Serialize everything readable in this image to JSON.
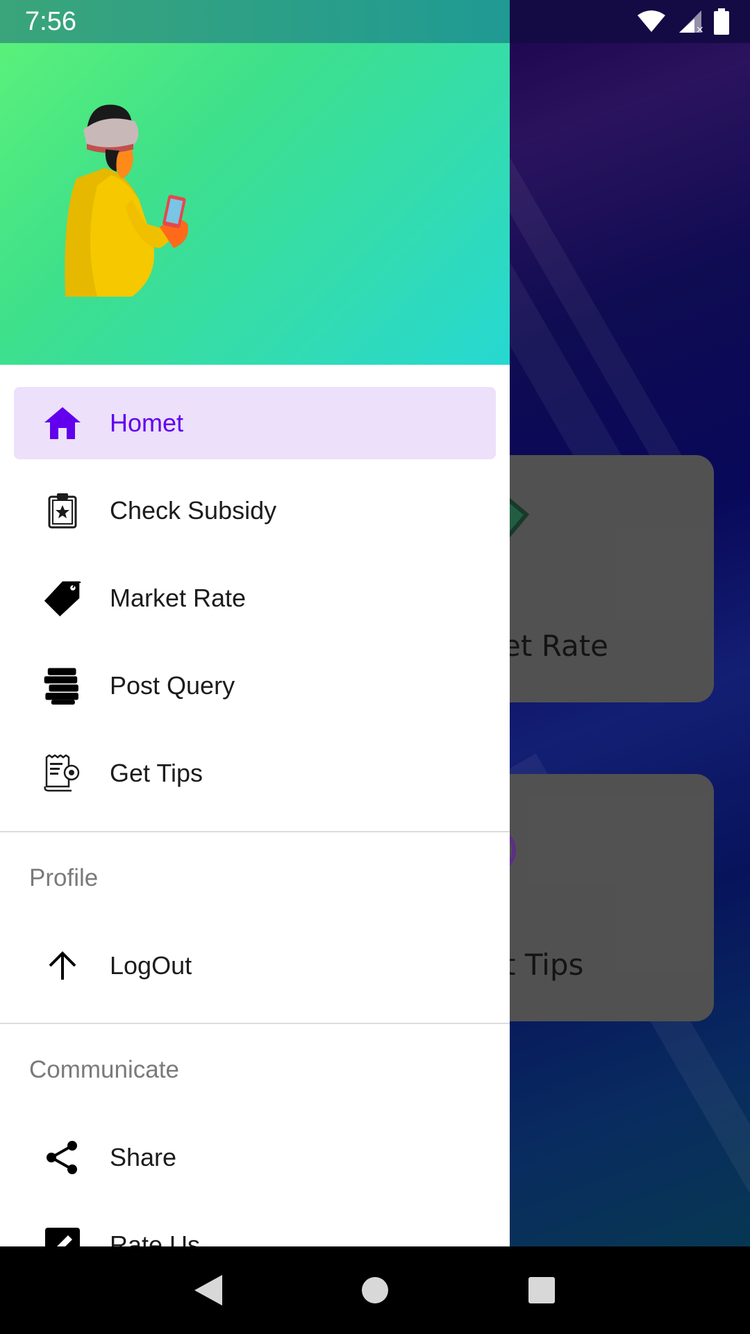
{
  "status_bar": {
    "time": "7:56"
  },
  "background_app": {
    "cards": [
      {
        "label": "Market Rate",
        "icon": "price-tag-icon"
      },
      {
        "label": "Get Tips",
        "icon": "tips-certificate-icon"
      }
    ]
  },
  "drawer": {
    "header": {
      "avatar": "farmer-with-phone-illustration"
    },
    "main_items": [
      {
        "label": "Homet",
        "icon": "home-icon",
        "active": true
      },
      {
        "label": "Check Subsidy",
        "icon": "clipboard-star-icon",
        "active": false
      },
      {
        "label": "Market Rate",
        "icon": "tag-icon",
        "active": false
      },
      {
        "label": "Post Query",
        "icon": "stack-icon",
        "active": false
      },
      {
        "label": "Get Tips",
        "icon": "tips-document-icon",
        "active": false
      }
    ],
    "profile_section": {
      "title": "Profile",
      "items": [
        {
          "label": "LogOut",
          "icon": "arrow-up-icon"
        }
      ]
    },
    "communicate_section": {
      "title": "Communicate",
      "items": [
        {
          "label": "Share",
          "icon": "share-icon"
        },
        {
          "label": "Rate Us",
          "icon": "rate-edit-icon"
        }
      ]
    }
  },
  "colors": {
    "accent": "#6200ee",
    "active_bg": "#ece0fa",
    "header_gradient_start": "#5af07a",
    "header_gradient_end": "#26d8d2"
  }
}
